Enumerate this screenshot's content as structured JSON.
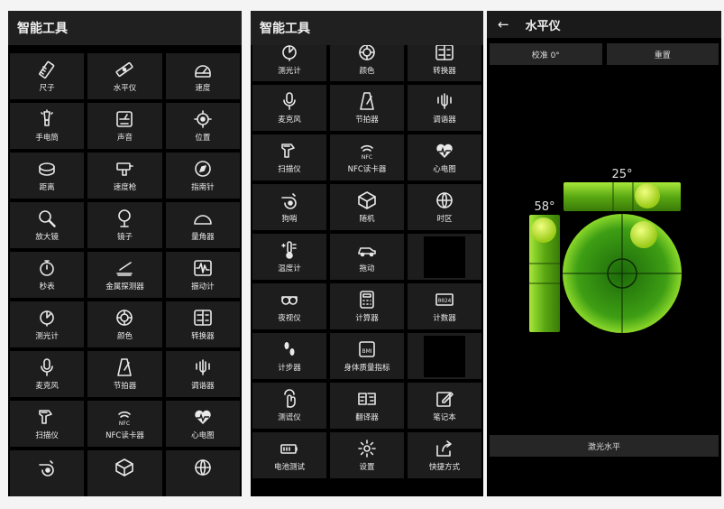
{
  "screen1": {
    "title": "智能工具",
    "tools": [
      {
        "label": "尺子",
        "icon": "ruler-icon"
      },
      {
        "label": "水平仪",
        "icon": "spirit-level-icon"
      },
      {
        "label": "速度",
        "icon": "speedometer-icon"
      },
      {
        "label": "手电筒",
        "icon": "flashlight-icon"
      },
      {
        "label": "声音",
        "icon": "sound-meter-icon"
      },
      {
        "label": "位置",
        "icon": "location-icon"
      },
      {
        "label": "距离",
        "icon": "tape-measure-icon"
      },
      {
        "label": "速度枪",
        "icon": "speed-gun-icon"
      },
      {
        "label": "指南针",
        "icon": "compass-icon"
      },
      {
        "label": "放大镜",
        "icon": "magnifier-icon"
      },
      {
        "label": "镜子",
        "icon": "mirror-icon"
      },
      {
        "label": "量角器",
        "icon": "protractor-icon"
      },
      {
        "label": "秒表",
        "icon": "stopwatch-icon"
      },
      {
        "label": "金属探测器",
        "icon": "metal-detector-icon"
      },
      {
        "label": "振动计",
        "icon": "vibrometer-icon"
      },
      {
        "label": "测光计",
        "icon": "light-meter-icon"
      },
      {
        "label": "颜色",
        "icon": "color-picker-icon"
      },
      {
        "label": "转换器",
        "icon": "converter-icon"
      },
      {
        "label": "麦克风",
        "icon": "microphone-icon"
      },
      {
        "label": "节拍器",
        "icon": "metronome-icon"
      },
      {
        "label": "调谐器",
        "icon": "tuner-icon"
      },
      {
        "label": "扫描仪",
        "icon": "barcode-scanner-icon"
      },
      {
        "label": "NFC读卡器",
        "icon": "nfc-icon"
      },
      {
        "label": "心电图",
        "icon": "heart-rate-icon"
      },
      {
        "label": "",
        "icon": "whistle-icon"
      },
      {
        "label": "",
        "icon": "random-dice-icon"
      },
      {
        "label": "",
        "icon": "world-clock-icon"
      }
    ]
  },
  "screen2": {
    "title": "智能工具",
    "tools": [
      {
        "label": "测光计",
        "icon": "light-meter-icon"
      },
      {
        "label": "颜色",
        "icon": "color-picker-icon"
      },
      {
        "label": "转换器",
        "icon": "converter-icon"
      },
      {
        "label": "麦克风",
        "icon": "microphone-icon"
      },
      {
        "label": "节拍器",
        "icon": "metronome-icon"
      },
      {
        "label": "调谐器",
        "icon": "tuner-icon"
      },
      {
        "label": "扫描仪",
        "icon": "barcode-scanner-icon"
      },
      {
        "label": "NFC读卡器",
        "icon": "nfc-icon"
      },
      {
        "label": "心电图",
        "icon": "heart-rate-icon"
      },
      {
        "label": "狗哨",
        "icon": "whistle-icon"
      },
      {
        "label": "随机",
        "icon": "random-dice-icon"
      },
      {
        "label": "时区",
        "icon": "world-clock-icon"
      },
      {
        "label": "温度计",
        "icon": "thermometer-icon"
      },
      {
        "label": "拖动",
        "icon": "car-icon"
      },
      {
        "label": "",
        "icon": ""
      },
      {
        "label": "夜视仪",
        "icon": "night-vision-icon"
      },
      {
        "label": "计算器",
        "icon": "calculator-icon"
      },
      {
        "label": "计数器",
        "icon": "counter-icon"
      },
      {
        "label": "计步器",
        "icon": "footsteps-icon"
      },
      {
        "label": "身体质量指标",
        "icon": "bmi-icon"
      },
      {
        "label": "",
        "icon": ""
      },
      {
        "label": "测谎仪",
        "icon": "lie-detector-icon"
      },
      {
        "label": "翻译器",
        "icon": "translator-icon"
      },
      {
        "label": "笔记本",
        "icon": "notebook-icon"
      },
      {
        "label": "电池测试",
        "icon": "battery-icon"
      },
      {
        "label": "设置",
        "icon": "settings-gear-icon"
      },
      {
        "label": "快捷方式",
        "icon": "shortcut-icon"
      }
    ]
  },
  "screen3": {
    "back_icon": "back-arrow-icon",
    "title": "水平仪",
    "calibrate_label": "校准 0°",
    "reset_label": "重置",
    "horizontal_angle": "25°",
    "vertical_angle": "58°",
    "laser_label": "激光水平"
  },
  "colors": {
    "background": "#000000",
    "tile": "#1d1d1d",
    "topbar": "#202020",
    "level_green": "#7cc81e",
    "bubble_yellow": "#d4f03a"
  }
}
